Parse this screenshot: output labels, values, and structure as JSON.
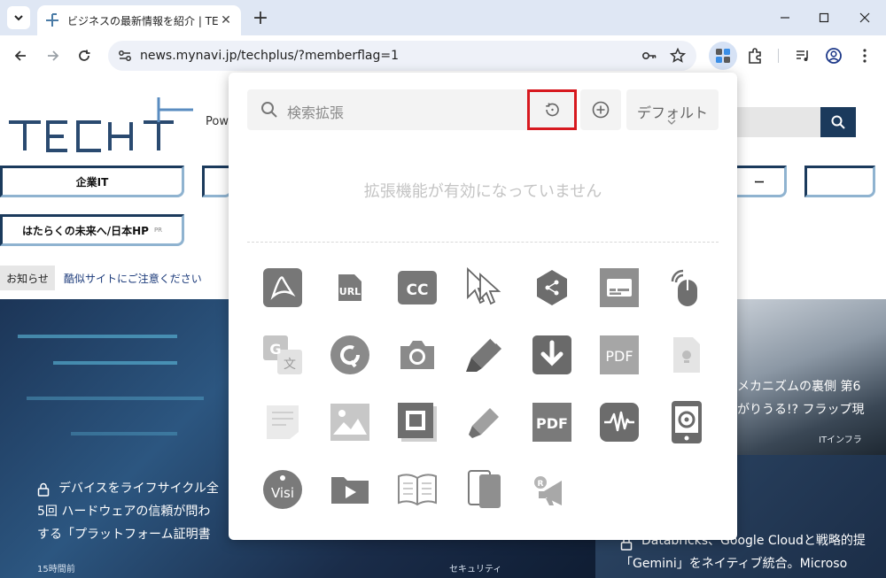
{
  "browser": {
    "tab_title": "ビジネスの最新情報を紹介 | TECH+",
    "new_tab_label": "+",
    "url": "news.mynavi.jp/techplus/?memberflag=1"
  },
  "page": {
    "powered_text": "Pow",
    "nav_buttons": [
      "企業IT",
      "はたらくの未来へ/日本HP"
    ],
    "nav_pr_badge": "PR",
    "nav_right_partial": "ー",
    "notice_label": "お知らせ",
    "notice_link": "酷似サイトにご注意ください",
    "hero_left": {
      "title_line1": "デバイスをライフサイクル全",
      "title_line2": "5回 ハードウェアの信頼が問わ",
      "title_line3": "する「プラットフォーム証明書",
      "time": "15時間前",
      "category": "セキュリティ"
    },
    "hero_right": {
      "title_line1": "メカニズムの裏側 第6",
      "title_line2": "がりうる!? フラップ現",
      "category": "ITインフラ"
    },
    "hero_right2": {
      "title_line1": "Databricks、Google Cloudと戦略的提",
      "title_line2": "「Gemini」をネイティブ統合。Microso"
    }
  },
  "extensions_popup": {
    "search_placeholder": "検索拡張",
    "default_label": "デフォルト",
    "empty_message": "拡張機能が有効になっていません",
    "icons": [
      "pdf-acrobat-icon",
      "url-shortener-icon",
      "closed-caption-icon",
      "cursor-arrows-icon",
      "share-hexagon-icon",
      "subtitles-icon",
      "mouse-gesture-icon",
      "google-translate-icon",
      "refresh-circle-icon",
      "camera-icon",
      "highlighter-icon",
      "download-arrow-icon",
      "pdf-tile-icon",
      "document-bulb-icon",
      "notes-icon",
      "image-icon",
      "window-frame-icon",
      "marker-pen-icon",
      "pdf-box-icon",
      "audio-wave-icon",
      "phone-device-icon",
      "visi-logo-icon",
      "video-folder-icon",
      "book-reader-icon",
      "dual-screen-icon",
      "megaphone-icon"
    ],
    "icon_texts": {
      "url": "URL",
      "cc": "CC",
      "pdf": "PDF",
      "g": "G",
      "wen": "文",
      "visi": "Visi",
      "r": "R"
    }
  }
}
